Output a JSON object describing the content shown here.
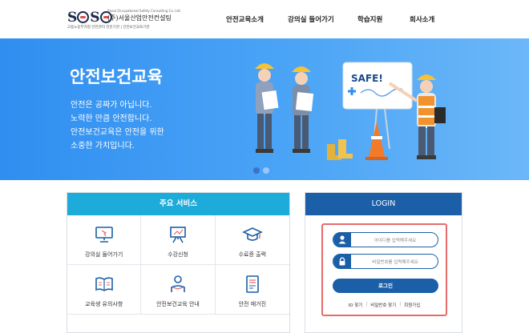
{
  "header": {
    "logo": {
      "mark": "SOSC",
      "name": "(주)서울산업안전컨설팅",
      "en": "Seoul Occupational Safety Consulting Co. Ltd.",
      "sub": "고용노동부지정 안전관리 전문기관  |  안전보건교육기관"
    },
    "nav": [
      "안전교육소개",
      "강의실 들어가기",
      "학습지원",
      "회사소개"
    ]
  },
  "hero": {
    "title": "안전보건교육",
    "lines": [
      "안전은 공짜가 아닙니다.",
      "노력한 만큼 안전합니다.",
      "안전보건교육은 안전을 위한",
      "소중한 가치입니다."
    ],
    "board_text": "SAFE!",
    "slides": [
      true,
      false
    ]
  },
  "services": {
    "title": "주요 서비스",
    "items": [
      {
        "label": "강의실 들어가기",
        "icon": "monitor-icon"
      },
      {
        "label": "수강신청",
        "icon": "easel-icon"
      },
      {
        "label": "수료증 출력",
        "icon": "graduation-cap-icon"
      },
      {
        "label": "교육생 유의사항",
        "icon": "book-icon"
      },
      {
        "label": "안전보건교육 안내",
        "icon": "reader-icon"
      },
      {
        "label": "안전 매거진",
        "icon": "magazine-icon"
      }
    ]
  },
  "login": {
    "title": "LOGIN",
    "id_placeholder": "아이디를 입력해주세요",
    "pw_placeholder": "비밀번호를 입력해주세요",
    "button": "로그인",
    "links": [
      "ID 찾기",
      "비밀번호 찾기",
      "회원가입"
    ]
  },
  "colors": {
    "accent": "#1b5fa8",
    "service_header": "#1dabd9",
    "hero": "#3f9af3",
    "highlight": "#e56b6b"
  }
}
